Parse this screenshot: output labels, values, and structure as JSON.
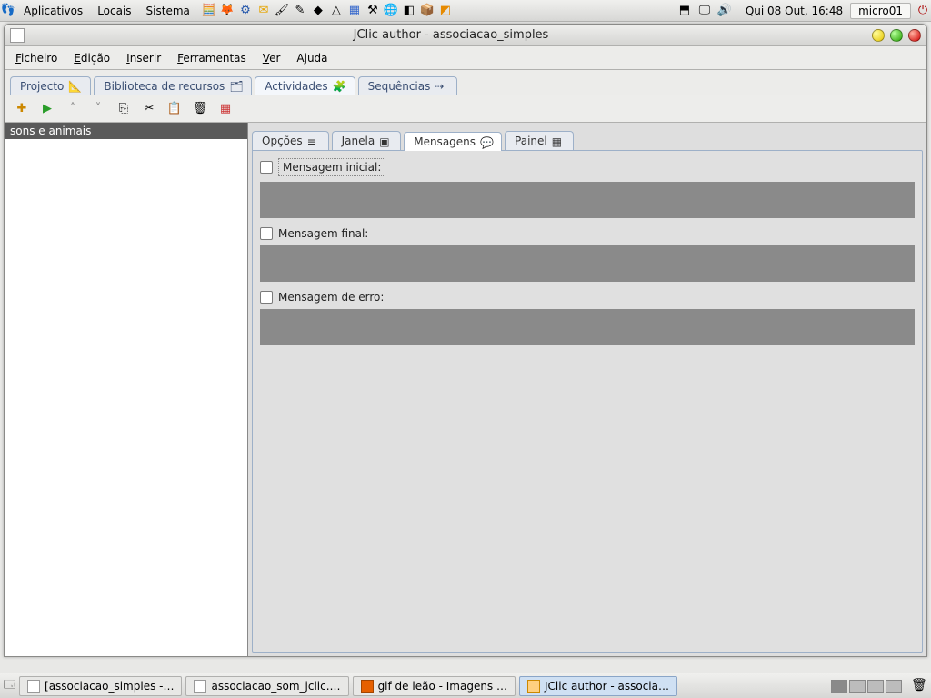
{
  "gnome": {
    "menus": [
      "Aplicativos",
      "Locais",
      "Sistema"
    ],
    "clock": "Qui 08 Out, 16:48",
    "host": "micro01"
  },
  "window": {
    "title": "JClic author - associacao_simples"
  },
  "menubar": [
    {
      "key": "F",
      "rest": "icheiro"
    },
    {
      "key": "E",
      "rest": "dição"
    },
    {
      "key": "I",
      "rest": "nserir"
    },
    {
      "key": "F",
      "rest": "erramentas"
    },
    {
      "key": "V",
      "rest": "er"
    },
    {
      "key": "A",
      "rest": "juda"
    }
  ],
  "upper_tabs": {
    "items": [
      {
        "label": "Projecto",
        "active": false
      },
      {
        "label": "Biblioteca de recursos",
        "active": false
      },
      {
        "label": "Actividades",
        "active": true
      },
      {
        "label": "Sequências",
        "active": false
      }
    ]
  },
  "toolbar_icons": [
    "new",
    "play",
    "up",
    "down",
    "copy",
    "cut",
    "paste",
    "delete",
    "grid"
  ],
  "sidebar": {
    "items": [
      "sons e animais"
    ]
  },
  "inner_tabs": {
    "items": [
      {
        "label": "Opções",
        "active": false
      },
      {
        "label": "Janela",
        "active": false
      },
      {
        "label": "Mensagens",
        "active": true
      },
      {
        "label": "Painel",
        "active": false
      }
    ]
  },
  "messages": {
    "initial": "Mensagem inicial:",
    "final": "Mensagem final:",
    "error": "Mensagem de erro:"
  },
  "taskbar": [
    {
      "label": "[associacao_simples -…",
      "active": false
    },
    {
      "label": "associacao_som_jclic.…",
      "active": false
    },
    {
      "label": "gif de leão - Imagens …",
      "active": false
    },
    {
      "label": "JClic author - associa…",
      "active": true
    }
  ]
}
